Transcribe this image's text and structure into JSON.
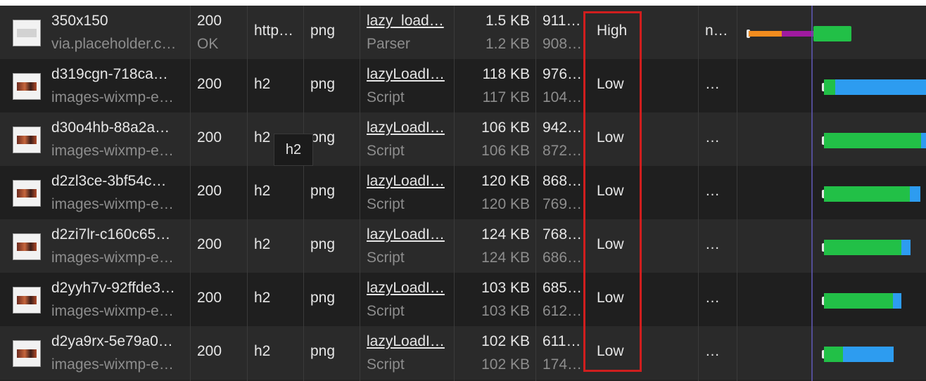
{
  "rows": [
    {
      "name": "350x150",
      "domain": "via.placeholder.c…",
      "status": "200",
      "status_text": "OK",
      "protocol": "http…",
      "type": "png",
      "initiator": "lazy_load…",
      "initiator_type": "Parser",
      "size": "1.5 KB",
      "resource_size": "1.2 KB",
      "time": "911…",
      "latency": "908…",
      "priority": "High",
      "extra": "n…",
      "thumb": "placeholder"
    },
    {
      "name": "d319cgn-718ca…",
      "domain": "images-wixmp-e…",
      "status": "200",
      "protocol": "h2",
      "type": "png",
      "initiator": "lazyLoadI…",
      "initiator_type": "Script",
      "size": "118 KB",
      "resource_size": "117 KB",
      "time": "976…",
      "latency": "104…",
      "priority": "Low",
      "extra": "…",
      "thumb": "image"
    },
    {
      "name": "d30o4hb-88a2a…",
      "domain": "images-wixmp-e…",
      "status": "200",
      "protocol": "h2",
      "type": "png",
      "initiator": "lazyLoadI…",
      "initiator_type": "Script",
      "size": "106 KB",
      "resource_size": "106 KB",
      "time": "942…",
      "latency": "872…",
      "priority": "Low",
      "extra": "…",
      "thumb": "image"
    },
    {
      "name": "d2zl3ce-3bf54c…",
      "domain": "images-wixmp-e…",
      "status": "200",
      "protocol": "h2",
      "type": "png",
      "initiator": "lazyLoadI…",
      "initiator_type": "Script",
      "size": "120 KB",
      "resource_size": "120 KB",
      "time": "868…",
      "latency": "769…",
      "priority": "Low",
      "extra": "…",
      "thumb": "image"
    },
    {
      "name": "d2zi7lr-c160c65…",
      "domain": "images-wixmp-e…",
      "status": "200",
      "protocol": "h2",
      "type": "png",
      "initiator": "lazyLoadI…",
      "initiator_type": "Script",
      "size": "124 KB",
      "resource_size": "124 KB",
      "time": "768…",
      "latency": "686…",
      "priority": "Low",
      "extra": "…",
      "thumb": "image"
    },
    {
      "name": "d2yyh7v-92ffde3…",
      "domain": "images-wixmp-e…",
      "status": "200",
      "protocol": "h2",
      "type": "png",
      "initiator": "lazyLoadI…",
      "initiator_type": "Script",
      "size": "103 KB",
      "resource_size": "103 KB",
      "time": "685…",
      "latency": "612…",
      "priority": "Low",
      "extra": "…",
      "thumb": "image"
    },
    {
      "name": "d2ya9rx-5e79a0…",
      "domain": "images-wixmp-e…",
      "status": "200",
      "protocol": "h2",
      "type": "png",
      "initiator": "lazyLoadI…",
      "initiator_type": "Script",
      "size": "102 KB",
      "resource_size": "102 KB",
      "time": "611…",
      "latency": "174…",
      "priority": "Low",
      "extra": "…",
      "thumb": "image"
    }
  ],
  "tooltip": "h2",
  "colors": {
    "highlight_box": "#d01e1e",
    "waterfall_green": "#22c047",
    "waterfall_blue": "#2d9cf0",
    "waterfall_orange": "#f28c1e",
    "waterfall_purple": "#a01aa0"
  }
}
